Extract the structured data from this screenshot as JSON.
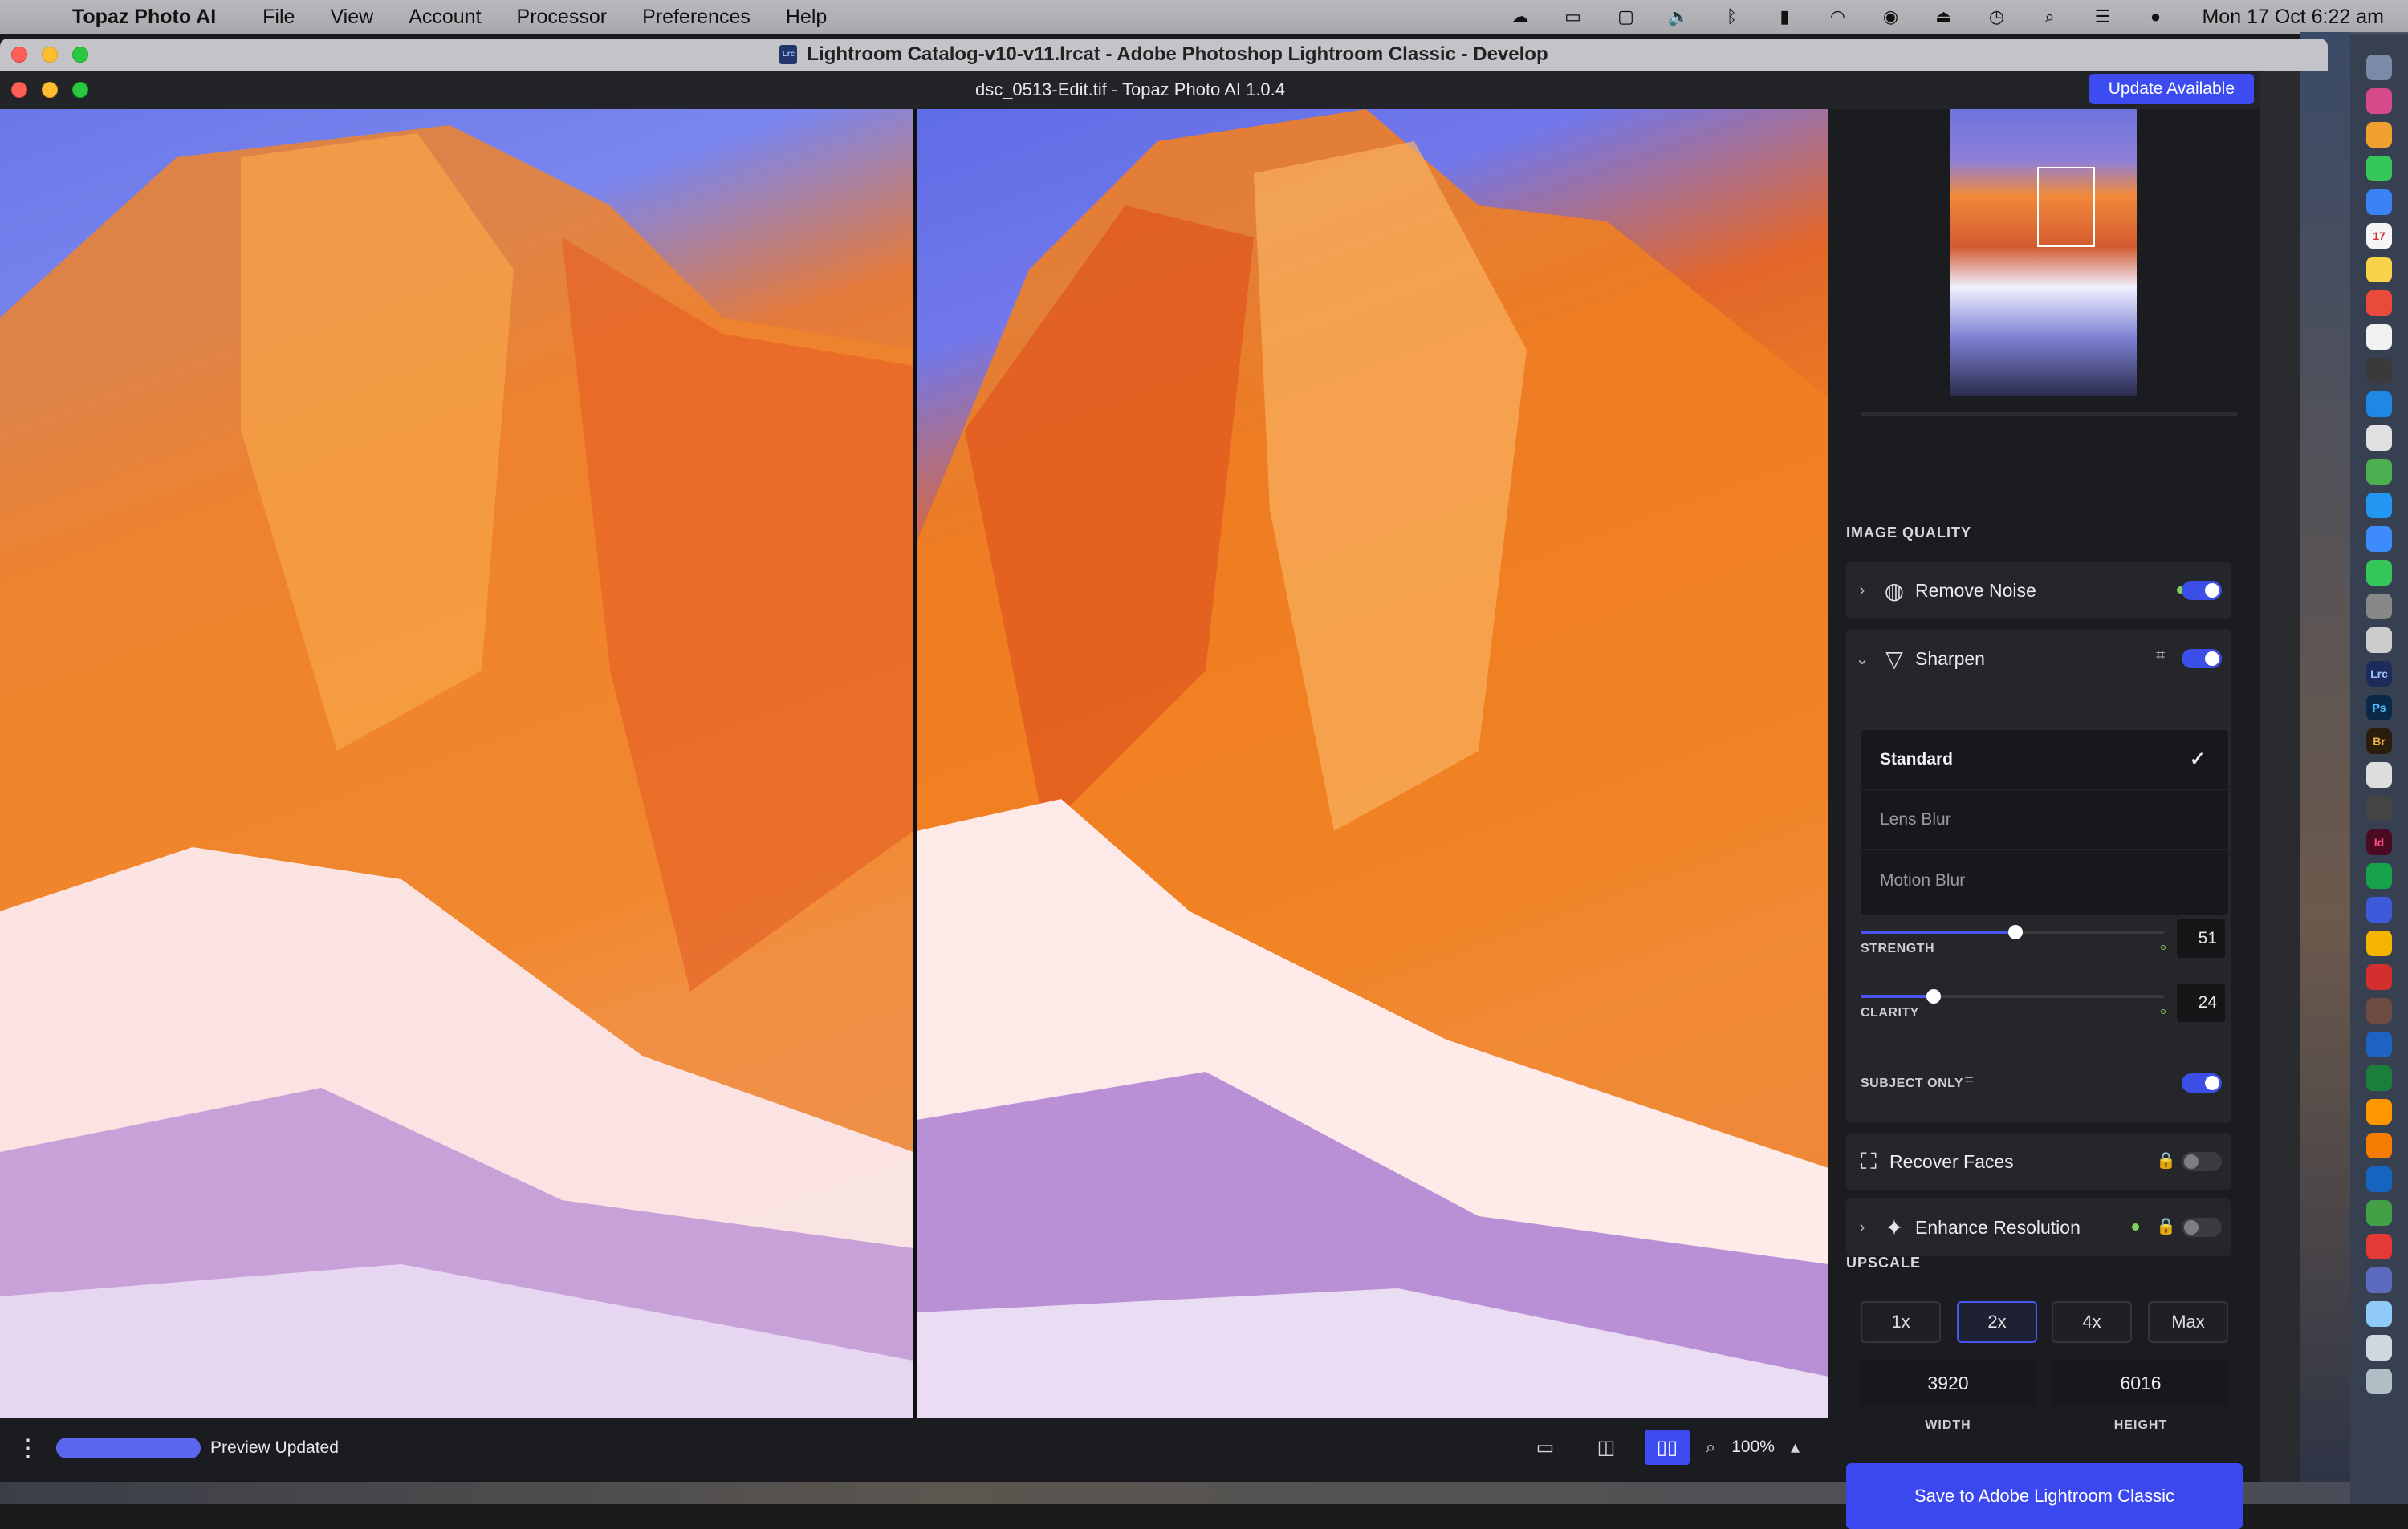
{
  "menubar": {
    "app_name": "Topaz Photo AI",
    "menus": [
      "File",
      "View",
      "Account",
      "Processor",
      "Preferences",
      "Help"
    ],
    "clock": "Mon 17 Oct  6:22 am",
    "status_icons": [
      "creative-cloud-icon",
      "screen-mirror-icon",
      "display-icon",
      "volume-icon",
      "bluetooth-icon",
      "battery-icon",
      "wifi-icon",
      "user-icon",
      "eject-icon",
      "time-machine-icon",
      "search-icon",
      "control-center-icon",
      "siri-icon"
    ]
  },
  "lightroom": {
    "window_title": "Lightroom Catalog-v10-v11.lrcat - Adobe Photoshop Lightroom Classic - Develop",
    "badge": "Lrc"
  },
  "topaz": {
    "window_title": "dsc_0513-Edit.tif - Topaz Photo AI 1.0.4",
    "update_label": "Update Available",
    "panel": {
      "image_quality_label": "IMAGE QUALITY",
      "remove_noise_label": "Remove Noise",
      "sharpen_label": "Sharpen",
      "sharpen_models": [
        "Standard",
        "Lens Blur",
        "Motion Blur"
      ],
      "selected_model": "Standard",
      "strength_label": "STRENGTH",
      "strength_value": "51",
      "clarity_label": "CLARITY",
      "clarity_value": "24",
      "subject_only_label": "SUBJECT ONLY",
      "recover_faces_label": "Recover Faces",
      "enhance_resolution_label": "Enhance Resolution",
      "upscale_label": "UPSCALE",
      "upscale_options": [
        "1x",
        "2x",
        "4x",
        "Max"
      ],
      "upscale_selected": "2x",
      "width_value": "3920",
      "height_value": "6016",
      "width_label": "WIDTH",
      "height_label": "HEIGHT",
      "save_label": "Save to Adobe Lightroom Classic",
      "toggles": {
        "remove_noise": true,
        "sharpen": true,
        "subject_only": true,
        "recover_faces": false,
        "enhance_resolution": false
      },
      "strength_fraction": 0.51,
      "clarity_fraction": 0.24
    },
    "bottombar": {
      "status": "Preview Updated",
      "zoom": "100%",
      "progress_fraction": 1.0
    }
  },
  "colors": {
    "accent": "#3d4cf0",
    "active_dot": "#7fd35e"
  }
}
